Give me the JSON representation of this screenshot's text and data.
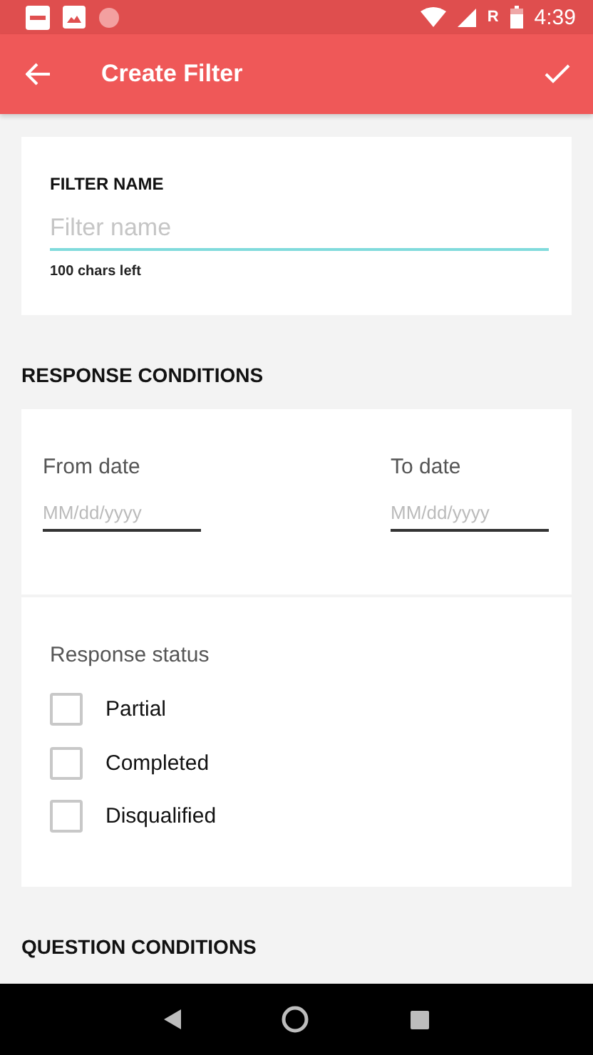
{
  "status_bar": {
    "roaming": "R",
    "time": "4:39"
  },
  "toolbar": {
    "title": "Create Filter"
  },
  "filter_name": {
    "label": "FILTER NAME",
    "placeholder": "Filter name",
    "hint": "100 chars left"
  },
  "response_conditions": {
    "heading": "RESPONSE CONDITIONS",
    "dates": [
      {
        "label": "From date",
        "placeholder": "MM/dd/yyyy"
      },
      {
        "label": "To date",
        "placeholder": "MM/dd/yyyy"
      }
    ],
    "status_label": "Response status",
    "statuses": [
      {
        "label": "Partial",
        "checked": false
      },
      {
        "label": "Completed",
        "checked": false
      },
      {
        "label": "Disqualified",
        "checked": false
      }
    ]
  },
  "question_conditions": {
    "heading": "QUESTION CONDITIONS"
  }
}
